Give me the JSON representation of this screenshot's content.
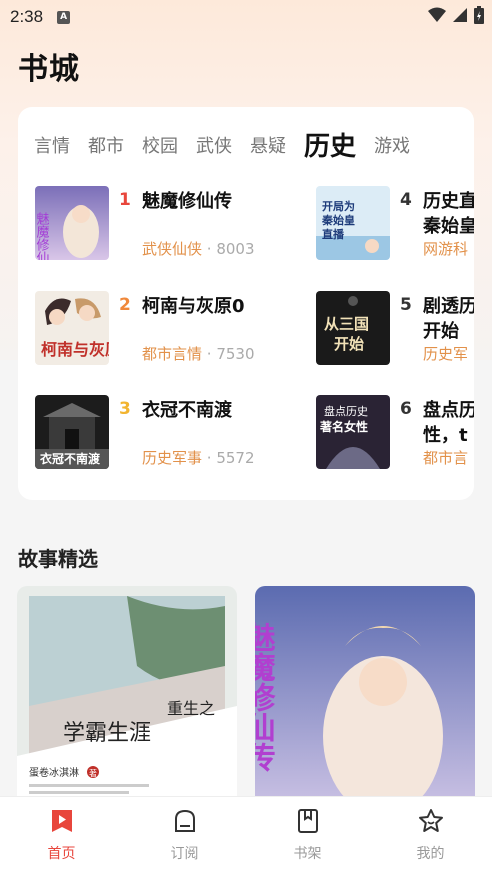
{
  "status_bar": {
    "time": "2:38",
    "notif_icon": "A"
  },
  "page_title": "书城",
  "tabs": [
    {
      "label": "言情",
      "active": false
    },
    {
      "label": "都市",
      "active": false
    },
    {
      "label": "校园",
      "active": false
    },
    {
      "label": "武侠",
      "active": false
    },
    {
      "label": "悬疑",
      "active": false
    },
    {
      "label": "历史",
      "active": true
    },
    {
      "label": "游戏",
      "active": false
    }
  ],
  "ranking": [
    {
      "rank": "1",
      "title": "魅魔修仙传",
      "category": "武侠仙侠",
      "count": "8003",
      "rank_color": "#e8463c",
      "cover_text": "魅魔修仙传"
    },
    {
      "rank": "2",
      "title": "柯南与灰原0",
      "category": "都市言情",
      "count": "7530",
      "rank_color": "#f0883a",
      "cover_text": "柯南与灰原"
    },
    {
      "rank": "3",
      "title": "衣冠不南渡",
      "category": "历史军事",
      "count": "5572",
      "rank_color": "#f2b430",
      "cover_text": "衣冠不南渡"
    },
    {
      "rank": "4",
      "title": "历史直",
      "title_line2": "秦始皇",
      "category": "网游科",
      "count": "",
      "rank_color": "#333",
      "cover_text": "开局为秦始皇直播"
    },
    {
      "rank": "5",
      "title": "剧透历",
      "title_line2": "开始",
      "category": "历史军",
      "count": "",
      "rank_color": "#333",
      "cover_text": "从三国开始"
    },
    {
      "rank": "6",
      "title": "盘点历",
      "title_line2": "性，t",
      "category": "都市言",
      "count": "",
      "rank_color": "#333",
      "cover_text": "盘点历史著名女性"
    }
  ],
  "meta_separator": " · ",
  "section_title": "故事精选",
  "stories": [
    {
      "title_line1": "重生之",
      "title_line2": "学霸生涯",
      "author": "蛋卷冰淇淋",
      "author_suffix": "著"
    },
    {
      "title": "魅魔修仙传"
    }
  ],
  "bottom_nav": [
    {
      "label": "首页",
      "icon": "bookmark-play-icon",
      "active": true
    },
    {
      "label": "订阅",
      "icon": "subscribe-icon",
      "active": false
    },
    {
      "label": "书架",
      "icon": "bookshelf-icon",
      "active": false
    },
    {
      "label": "我的",
      "icon": "star-face-icon",
      "active": false
    }
  ],
  "colors": {
    "accent": "#e8463c",
    "category": "#e2914a",
    "muted": "#aaaaaa"
  }
}
